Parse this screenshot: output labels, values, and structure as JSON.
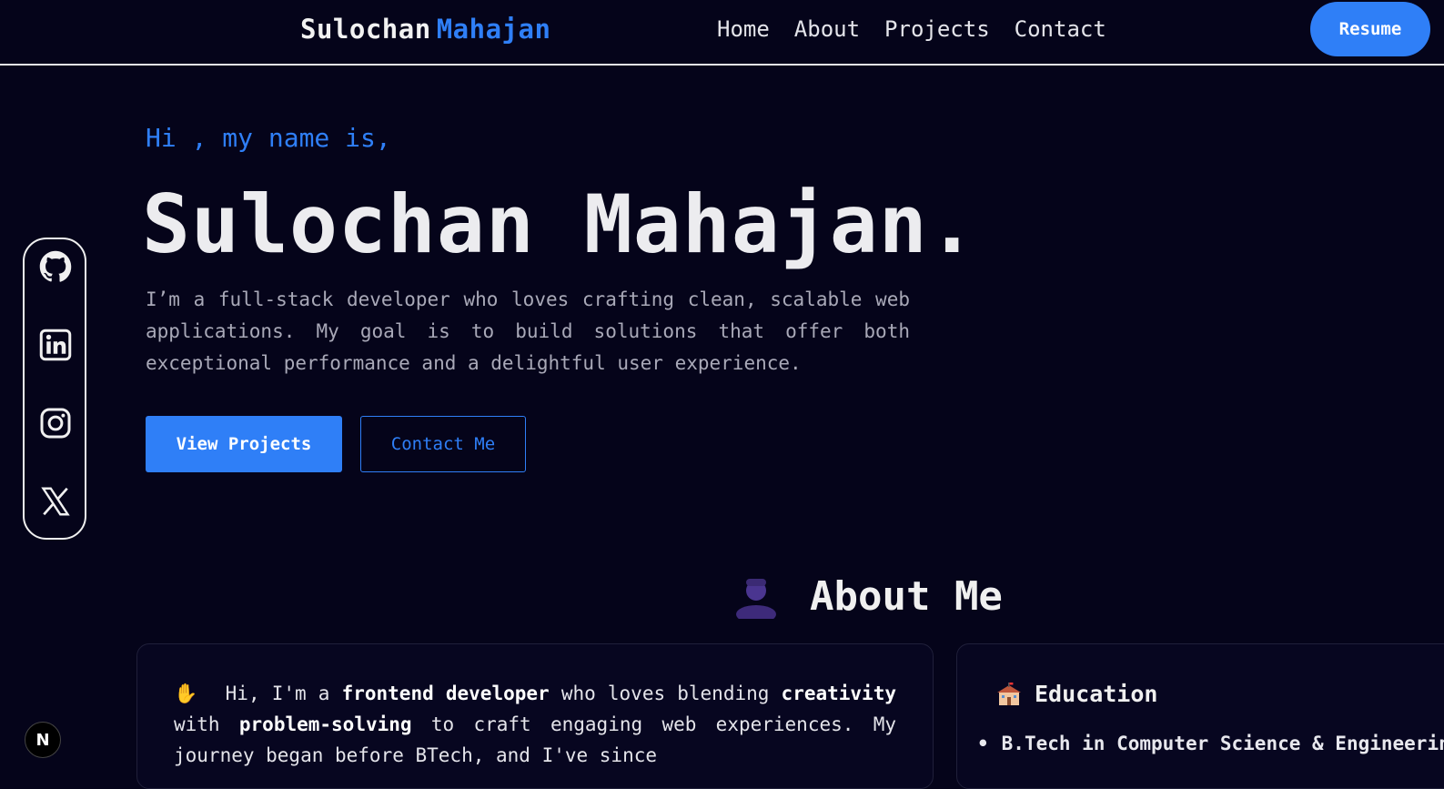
{
  "nav": {
    "brand_first": "Sulochan",
    "brand_last": "Mahajan",
    "links": [
      {
        "label": "Home"
      },
      {
        "label": "About"
      },
      {
        "label": "Projects"
      },
      {
        "label": "Contact"
      }
    ],
    "resume_label": "Resume"
  },
  "hero": {
    "greeting": "Hi , my name is,",
    "name": "Sulochan Mahajan.",
    "description": "I’m a full-stack developer who loves crafting clean, scalable web applications. My goal is to build solutions that offer both exceptional performance and a delightful user experience.",
    "primary_button": "View Projects",
    "secondary_button": "Contact Me"
  },
  "social": [
    {
      "icon": "github-icon"
    },
    {
      "icon": "linkedin-icon"
    },
    {
      "icon": "instagram-icon"
    },
    {
      "icon": "x-twitter-icon"
    }
  ],
  "about": {
    "title": "About Me",
    "title_icon": "person-silhouette-icon",
    "intro_icon": "waving-hand-icon",
    "p1": "Hi, I'm a ",
    "b1": "frontend developer",
    "p2": " who loves blending ",
    "b2": "creativity",
    "p3": " with ",
    "b3": "problem-solving",
    "p4": " to craft engaging web experiences. My journey began before BTech, and I've since"
  },
  "education": {
    "title": "Education",
    "icon": "school-building-icon",
    "items": [
      "B.Tech in Computer Science & Engineering"
    ]
  },
  "badge": {
    "label": "N"
  },
  "colors": {
    "background": "#05041a",
    "accent": "#2f7ff7",
    "text": "#e8e8ee"
  }
}
